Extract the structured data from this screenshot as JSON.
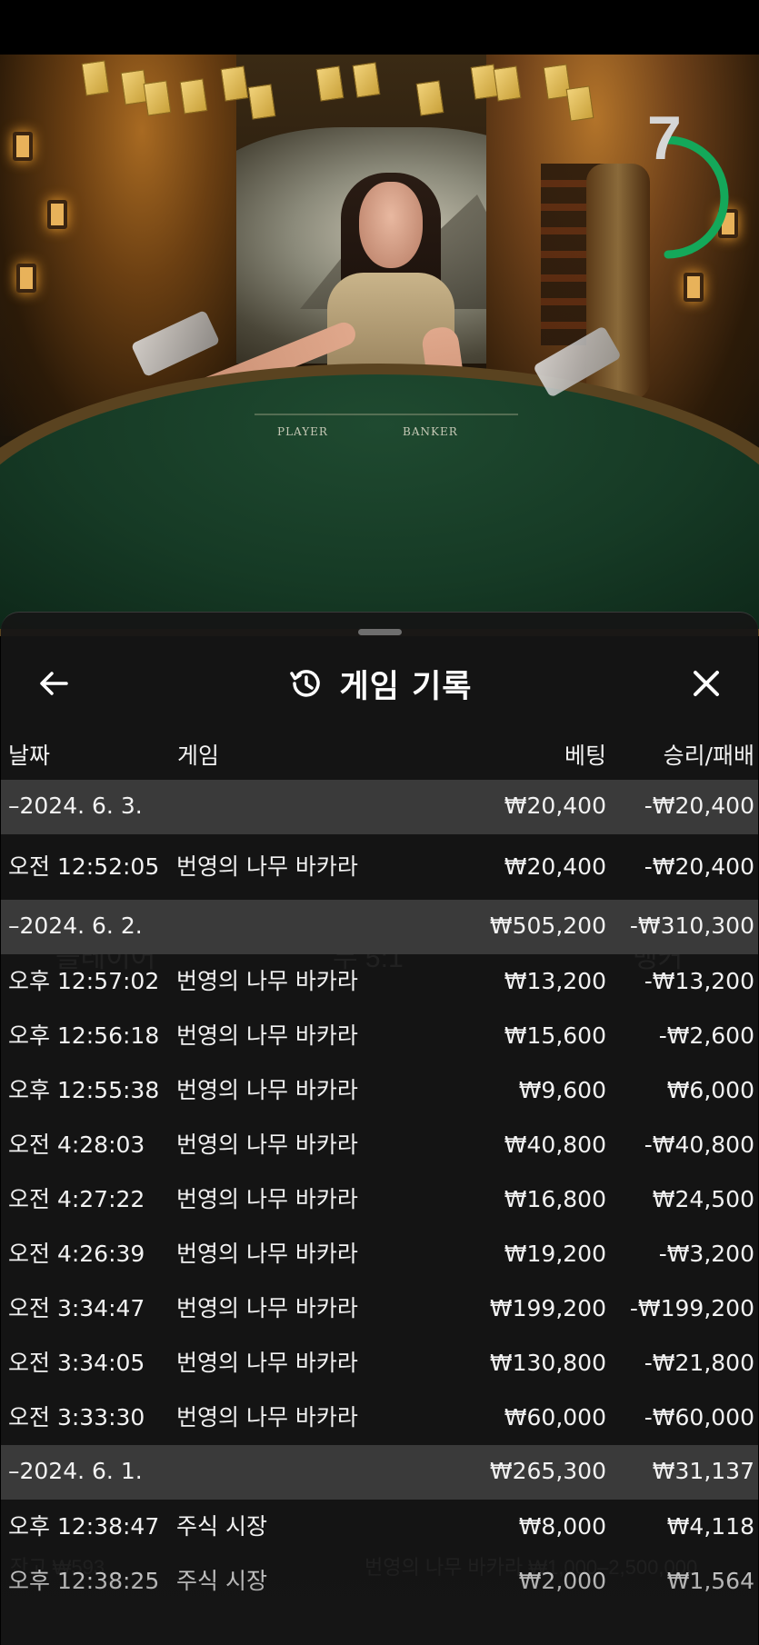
{
  "video": {
    "timer_value": "7",
    "table_labels": {
      "player": "PLAYER",
      "banker": "BANKER"
    }
  },
  "sheet": {
    "title": "게임 기록",
    "icons": {
      "back": "arrow-left-icon",
      "history": "history-icon",
      "close": "close-icon"
    },
    "columns": {
      "date": "날짜",
      "game": "게임",
      "bet": "베팅",
      "result": "승리/패배"
    }
  },
  "history": [
    {
      "type": "group",
      "date": "–2024. 6. 3.",
      "bet": "₩20,400",
      "result": "-₩20,400"
    },
    {
      "type": "item",
      "time": "오전 12:52:05",
      "game": "번영의 나무 바카라",
      "bet": "₩20,400",
      "result": "-₩20,400"
    },
    {
      "type": "group",
      "date": "–2024. 6. 2.",
      "bet": "₩505,200",
      "result": "-₩310,300"
    },
    {
      "type": "item",
      "time": "오후 12:57:02",
      "game": "번영의 나무 바카라",
      "bet": "₩13,200",
      "result": "-₩13,200"
    },
    {
      "type": "item",
      "time": "오후 12:56:18",
      "game": "번영의 나무 바카라",
      "bet": "₩15,600",
      "result": "-₩2,600"
    },
    {
      "type": "item",
      "time": "오후 12:55:38",
      "game": "번영의 나무 바카라",
      "bet": "₩9,600",
      "result": "₩6,000"
    },
    {
      "type": "item",
      "time": "오전 4:28:03",
      "game": "번영의 나무 바카라",
      "bet": "₩40,800",
      "result": "-₩40,800"
    },
    {
      "type": "item",
      "time": "오전 4:27:22",
      "game": "번영의 나무 바카라",
      "bet": "₩16,800",
      "result": "₩24,500"
    },
    {
      "type": "item",
      "time": "오전 4:26:39",
      "game": "번영의 나무 바카라",
      "bet": "₩19,200",
      "result": "-₩3,200"
    },
    {
      "type": "item",
      "time": "오전 3:34:47",
      "game": "번영의 나무 바카라",
      "bet": "₩199,200",
      "result": "-₩199,200"
    },
    {
      "type": "item",
      "time": "오전 3:34:05",
      "game": "번영의 나무 바카라",
      "bet": "₩130,800",
      "result": "-₩21,800"
    },
    {
      "type": "item",
      "time": "오전 3:33:30",
      "game": "번영의 나무 바카라",
      "bet": "₩60,000",
      "result": "-₩60,000"
    },
    {
      "type": "group",
      "date": "–2024. 6. 1.",
      "bet": "₩265,300",
      "result": "₩31,137"
    },
    {
      "type": "item",
      "time": "오후 12:38:47",
      "game": "주식 시장",
      "bet": "₩8,000",
      "result": "₩4,118"
    },
    {
      "type": "item",
      "time": "오후 12:38:25",
      "game": "주식 시장",
      "bet": "₩2,000",
      "result": "₩1,564"
    }
  ],
  "background_ghost": {
    "player": "플레이어",
    "tie": "무 5:1",
    "banker": "뱅커",
    "balance": "잔고 ₩593",
    "table_limits": "번영의 나무 바카라 ₩1,000–2,500,000"
  }
}
